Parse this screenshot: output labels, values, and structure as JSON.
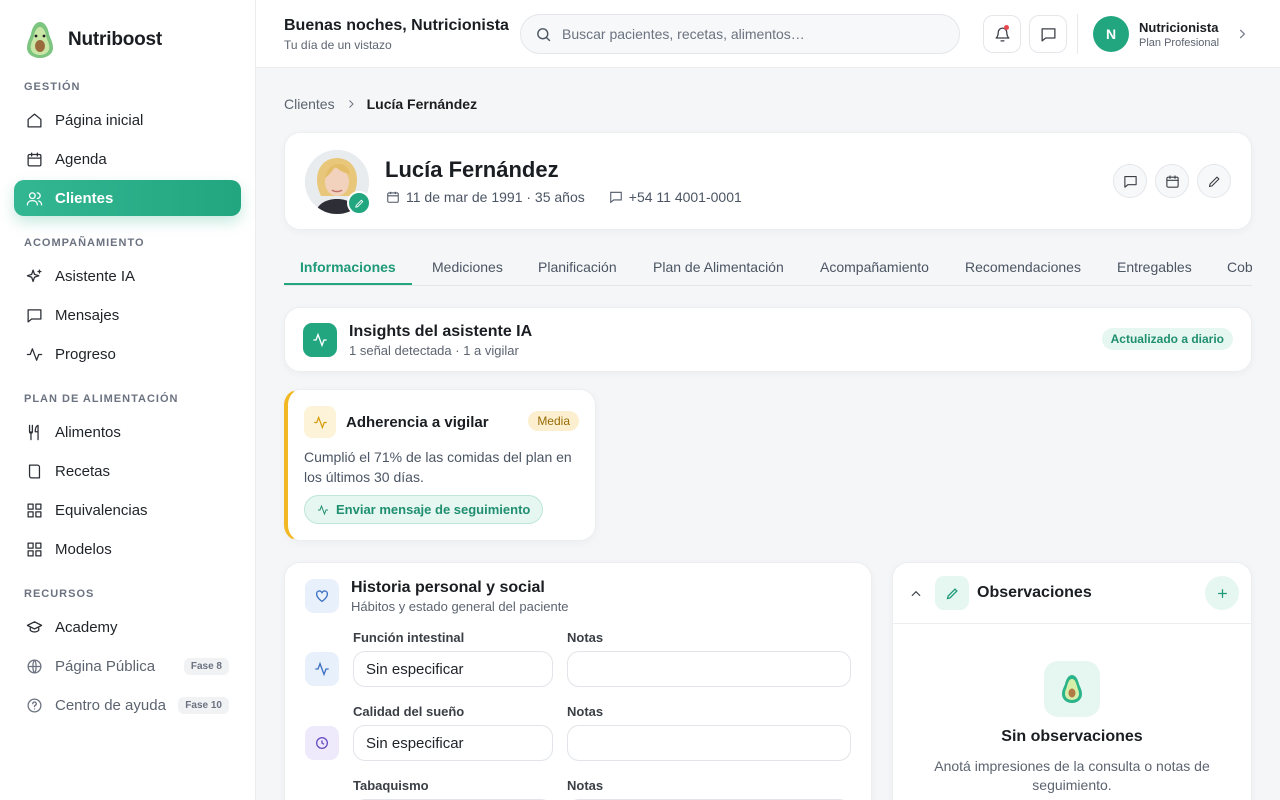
{
  "app": {
    "name": "Nutriboost"
  },
  "sidebar": {
    "sections": [
      {
        "title": "GESTIÓN"
      },
      {
        "title": "ACOMPAÑAMIENTO"
      },
      {
        "title": "PLAN DE ALIMENTACIÓN"
      },
      {
        "title": "RECURSOS"
      }
    ],
    "items": [
      {
        "label": "Página inicial",
        "icon": "home-icon"
      },
      {
        "label": "Agenda",
        "icon": "calendar-icon"
      },
      {
        "label": "Clientes",
        "icon": "users-icon",
        "active": true
      },
      {
        "label": "Asistente IA",
        "icon": "sparkle-icon"
      },
      {
        "label": "Mensajes",
        "icon": "message-icon"
      },
      {
        "label": "Progreso",
        "icon": "activity-icon"
      },
      {
        "label": "Alimentos",
        "icon": "utensils-icon"
      },
      {
        "label": "Recetas",
        "icon": "book-icon"
      },
      {
        "label": "Equivalencias",
        "icon": "grid-icon"
      },
      {
        "label": "Modelos",
        "icon": "grid-icon"
      },
      {
        "label": "Academy",
        "icon": "graduation-cap-icon"
      },
      {
        "label": "Página Pública",
        "icon": "globe-icon",
        "badge": "Fase 8"
      },
      {
        "label": "Centro de ayuda",
        "icon": "help-circle-icon",
        "badge": "Fase 10"
      }
    ]
  },
  "header": {
    "greeting": "Buenas noches, Nutricionista",
    "subtitle": "Tu día de un vistazo",
    "search_placeholder": "Buscar pacientes, recetas, alimentos…",
    "user": {
      "initial": "N",
      "name": "Nutricionista",
      "plan": "Plan Profesional"
    }
  },
  "breadcrumb": {
    "parent": "Clientes",
    "current": "Lucía Fernández"
  },
  "profile": {
    "name": "Lucía Fernández",
    "birth": "11 de mar de 1991 · 35 años",
    "phone": "+54 11 4001-0001"
  },
  "tabs": [
    {
      "label": "Informaciones",
      "active": true
    },
    {
      "label": "Mediciones"
    },
    {
      "label": "Planificación"
    },
    {
      "label": "Plan de Alimentación"
    },
    {
      "label": "Acompañamiento"
    },
    {
      "label": "Recomendaciones"
    },
    {
      "label": "Entregables"
    },
    {
      "label": "Cob"
    }
  ],
  "insights": {
    "title": "Insights del asistente IA",
    "subtitle": "1 señal detectada · 1 a vigilar",
    "badge": "Actualizado a diario"
  },
  "adherence": {
    "title": "Adherencia a vigilar",
    "level": "Media",
    "text": "Cumplió el 71% de las comidas del plan en los últimos 30 días.",
    "action": "Enviar mensaje de seguimiento"
  },
  "history": {
    "title": "Historia personal y social",
    "subtitle": "Hábitos y estado general del paciente",
    "fields": [
      {
        "label": "Función intestinal",
        "value": "Sin especificar",
        "notes_label": "Notas",
        "notes": ""
      },
      {
        "label": "Calidad del sueño",
        "value": "Sin especificar",
        "notes_label": "Notas",
        "notes": ""
      },
      {
        "label": "Tabaquismo",
        "value": "",
        "notes_label": "Notas",
        "notes": ""
      }
    ]
  },
  "observations": {
    "title": "Observaciones",
    "empty_title": "Sin observaciones",
    "empty_text": "Anotá impresiones de la consulta o notas de seguimiento."
  },
  "colors": {
    "accent": "#22a67f",
    "warning": "#f2b824"
  }
}
